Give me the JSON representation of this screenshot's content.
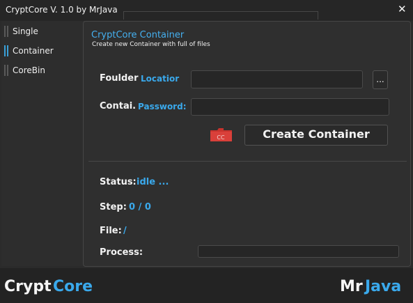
{
  "window": {
    "title": "CryptCore V. 1.0 by MrJava",
    "close_icon": "✕"
  },
  "sidebar": {
    "items": [
      {
        "label": "Single",
        "active": false
      },
      {
        "label": "Container",
        "active": true
      },
      {
        "label": "CoreBin",
        "active": false
      }
    ]
  },
  "panel": {
    "title": "CryptCore Container",
    "subtitle": "Create new Container with full of files",
    "folder": {
      "label_white": "Foulder",
      "label_blue": "Locatior",
      "value": "",
      "browse_label": "..."
    },
    "password": {
      "label_white": "Contai.",
      "label_blue": "Password:",
      "value": ""
    },
    "folder_icon_text": "CC",
    "create_button_label": "Create Container",
    "status": {
      "label": "Status:",
      "value": "idle ..."
    },
    "step": {
      "label": "Step:",
      "value": "0 / 0"
    },
    "file": {
      "label": "File:",
      "value": "/"
    },
    "process": {
      "label": "Process:",
      "progress": 0
    }
  },
  "footer": {
    "left_white": "Crypt",
    "left_blue": "Core",
    "right_white": "Mr",
    "right_blue": "Java"
  },
  "colors": {
    "accent": "#3aa9ec",
    "background": "#2b2b2b",
    "folder_icon": "#d9403a"
  }
}
